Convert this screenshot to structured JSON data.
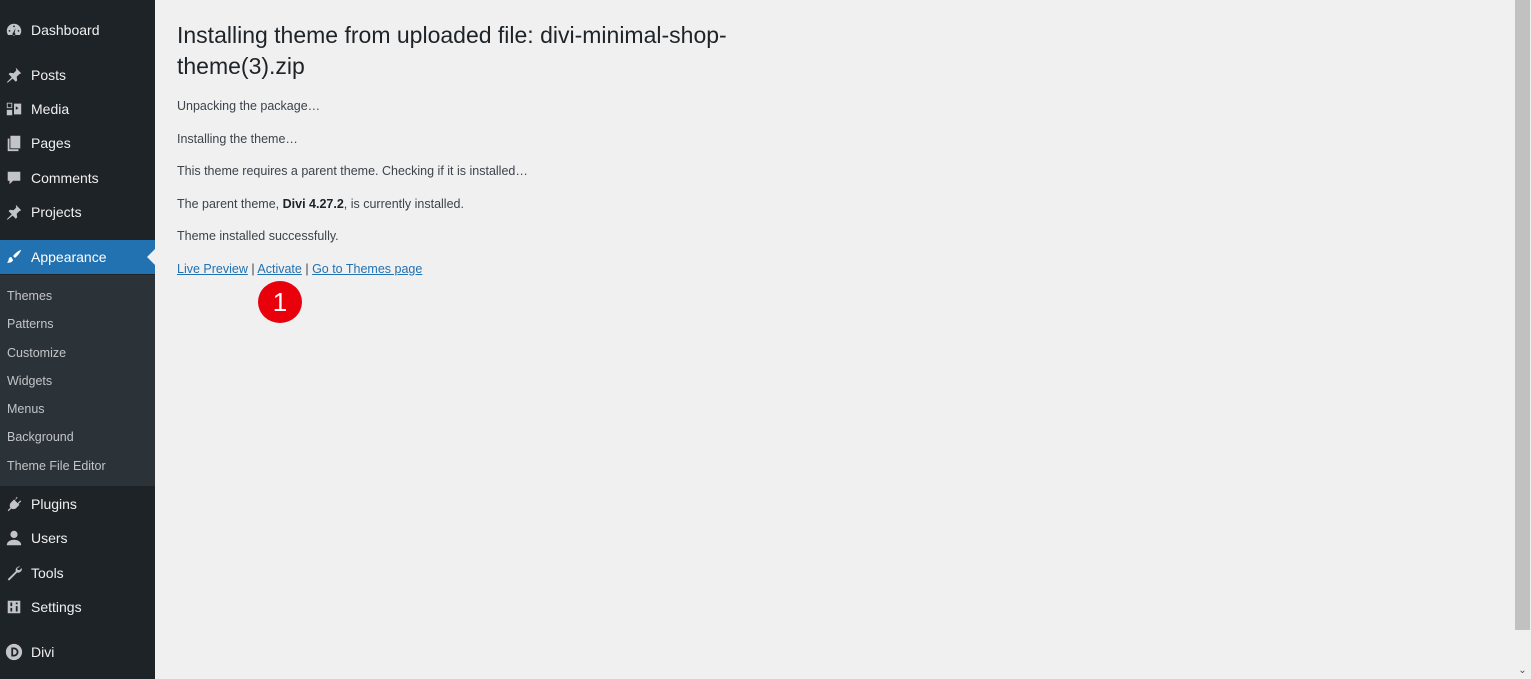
{
  "sidebar": {
    "items": [
      {
        "label": "Dashboard",
        "icon": "dashboard-icon"
      },
      {
        "label": "Posts",
        "icon": "pin-icon"
      },
      {
        "label": "Media",
        "icon": "media-icon"
      },
      {
        "label": "Pages",
        "icon": "pages-icon"
      },
      {
        "label": "Comments",
        "icon": "comments-icon"
      },
      {
        "label": "Projects",
        "icon": "pin-icon"
      },
      {
        "label": "Appearance",
        "icon": "brush-icon"
      },
      {
        "label": "Plugins",
        "icon": "plugin-icon"
      },
      {
        "label": "Users",
        "icon": "user-icon"
      },
      {
        "label": "Tools",
        "icon": "wrench-icon"
      },
      {
        "label": "Settings",
        "icon": "settings-icon"
      },
      {
        "label": "Divi",
        "icon": "divi-icon"
      }
    ],
    "submenu": [
      "Themes",
      "Patterns",
      "Customize",
      "Widgets",
      "Menus",
      "Background",
      "Theme File Editor"
    ]
  },
  "main": {
    "title": "Installing theme from uploaded file: divi-minimal-shop-theme(3).zip",
    "messages": {
      "unpacking": "Unpacking the package…",
      "installing": "Installing the theme…",
      "requires_parent": "This theme requires a parent theme. Checking if it is installed…",
      "parent_prefix": "The parent theme, ",
      "parent_name": "Divi 4.27.2",
      "parent_suffix": ", is currently installed.",
      "success": "Theme installed successfully."
    },
    "links": {
      "live_preview": "Live Preview",
      "activate": "Activate",
      "themes_page": "Go to Themes page",
      "separator": " | "
    }
  },
  "annotation": {
    "number": "1",
    "color": "#e8000b"
  },
  "colors": {
    "sidebar_bg": "#1d2327",
    "submenu_bg": "#2c3338",
    "accent": "#2271b1",
    "page_bg": "#f0f0f1"
  }
}
